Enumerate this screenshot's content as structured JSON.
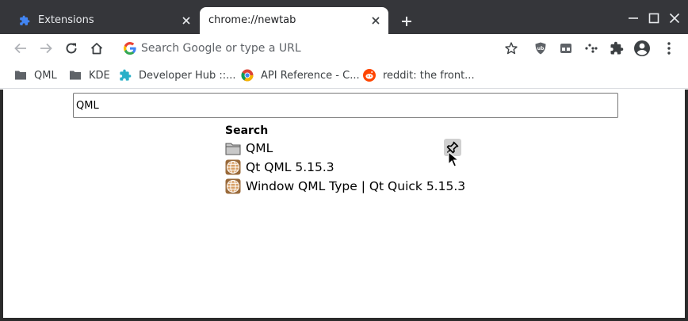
{
  "tabs": [
    {
      "title": "Extensions",
      "favicon": "puzzle-icon",
      "active": false
    },
    {
      "title": "chrome://newtab",
      "active": true
    }
  ],
  "toolbar": {
    "omnibox_placeholder": "Search Google or type a URL"
  },
  "bookmarks": [
    {
      "label": "QML",
      "icon": "folder-icon"
    },
    {
      "label": "KDE",
      "icon": "folder-icon"
    },
    {
      "label": "Developer Hub ::...",
      "icon": "puzzle-icon"
    },
    {
      "label": "API Reference - C...",
      "icon": "chrome-icon"
    },
    {
      "label": "reddit: the front...",
      "icon": "reddit-icon"
    }
  ],
  "page": {
    "search_value": "QML",
    "results_heading": "Search",
    "results": [
      {
        "label": "QML",
        "icon": "folder-icon"
      },
      {
        "label": "Qt QML 5.15.3",
        "icon": "globe-icon"
      },
      {
        "label": "Window QML Type | Qt Quick 5.15.3",
        "icon": "globe-icon"
      }
    ]
  },
  "colors": {
    "tabstrip_bg": "#35363a",
    "accent_blue": "#1a73e8",
    "reddit_orange": "#ff4500",
    "devhub_teal": "#2ab0c8"
  }
}
